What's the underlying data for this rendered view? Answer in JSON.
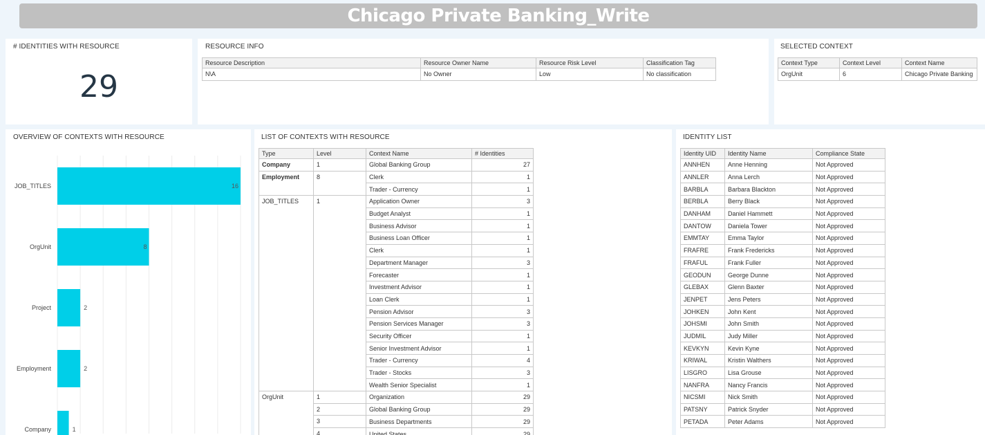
{
  "header": {
    "title": "Chicago Private Banking_Write"
  },
  "identities_panel": {
    "title": "# IDENTITIES WITH RESOURCE",
    "value": "29"
  },
  "resource_info": {
    "title": "RESOURCE INFO",
    "columns": [
      "Resource Description",
      "Resource Owner Name",
      "Resource Risk Level",
      "Classification Tag"
    ],
    "row": [
      "N\\A",
      "No Owner",
      "Low",
      "No classification"
    ]
  },
  "selected_context": {
    "title": "SELECTED CONTEXT",
    "columns": [
      "Context Type",
      "Context Level",
      "Context Name"
    ],
    "row": [
      "OrgUnit",
      "6",
      "Chicago Private Banking"
    ]
  },
  "overview": {
    "title": "OVERVIEW OF CONTEXTS WITH RESOURCE",
    "accent": "#00cfe8"
  },
  "chart_data": {
    "type": "bar",
    "orientation": "horizontal",
    "categories": [
      "JOB_TITLES",
      "OrgUnit",
      "Project",
      "Employment",
      "Company"
    ],
    "values": [
      16,
      8,
      2,
      2,
      1
    ],
    "xlim": [
      0,
      16
    ],
    "grid": true,
    "title": "",
    "xlabel": "",
    "ylabel": ""
  },
  "context_list": {
    "title": "LIST OF CONTEXTS WITH RESOURCE",
    "columns": [
      "Type",
      "Level",
      "Context Name",
      "# Identities"
    ],
    "groups": [
      {
        "type": "Company",
        "bold": true,
        "levels": [
          {
            "level": "1",
            "rows": [
              [
                "Global Banking Group",
                "27"
              ]
            ]
          }
        ]
      },
      {
        "type": "Employment",
        "bold": true,
        "levels": [
          {
            "level": "8",
            "rows": [
              [
                "Clerk",
                "1"
              ],
              [
                "Trader - Currency",
                "1"
              ]
            ]
          }
        ]
      },
      {
        "type": "JOB_TITLES",
        "bold": false,
        "levels": [
          {
            "level": "1",
            "rows": [
              [
                "Application Owner",
                "3"
              ],
              [
                "Budget Analyst",
                "1"
              ],
              [
                "Business Advisor",
                "1"
              ],
              [
                "Business Loan Officer",
                "1"
              ],
              [
                "Clerk",
                "1"
              ],
              [
                "Department Manager",
                "3"
              ],
              [
                "Forecaster",
                "1"
              ],
              [
                "Investment Advisor",
                "1"
              ],
              [
                "Loan Clerk",
                "1"
              ],
              [
                "Pension Advisor",
                "3"
              ],
              [
                "Pension Services Manager",
                "3"
              ],
              [
                "Security Officer",
                "1"
              ],
              [
                "Senior Investment Advisor",
                "1"
              ],
              [
                "Trader - Currency",
                "4"
              ],
              [
                "Trader - Stocks",
                "3"
              ],
              [
                "Wealth Senior Specialist",
                "1"
              ]
            ]
          }
        ]
      },
      {
        "type": "OrgUnit",
        "bold": false,
        "levels": [
          {
            "level": "1",
            "rows": [
              [
                "Organization",
                "29"
              ]
            ]
          },
          {
            "level": "2",
            "rows": [
              [
                "Global Banking Group",
                "29"
              ]
            ]
          },
          {
            "level": "3",
            "rows": [
              [
                "Business Departments",
                "29"
              ]
            ]
          },
          {
            "level": "4",
            "rows": [
              [
                "United States",
                "29"
              ]
            ]
          }
        ]
      }
    ]
  },
  "identity_list": {
    "title": "IDENTITY LIST",
    "columns": [
      "Identity UID",
      "Identity Name",
      "Compliance State"
    ],
    "rows": [
      [
        "ANNHEN",
        "Anne Henning",
        "Not Approved"
      ],
      [
        "ANNLER",
        "Anna Lerch",
        "Not Approved"
      ],
      [
        "BARBLA",
        "Barbara Blackton",
        "Not Approved"
      ],
      [
        "BERBLA",
        "Berry Black",
        "Not Approved"
      ],
      [
        "DANHAM",
        "Daniel Hammett",
        "Not Approved"
      ],
      [
        "DANTOW",
        "Daniela Tower",
        "Not Approved"
      ],
      [
        "EMMTAY",
        "Emma Taylor",
        "Not Approved"
      ],
      [
        "FRAFRE",
        "Frank Fredericks",
        "Not Approved"
      ],
      [
        "FRAFUL",
        "Frank Fuller",
        "Not Approved"
      ],
      [
        "GEODUN",
        "George Dunne",
        "Not Approved"
      ],
      [
        "GLEBAX",
        "Glenn Baxter",
        "Not Approved"
      ],
      [
        "JENPET",
        "Jens Peters",
        "Not Approved"
      ],
      [
        "JOHKEN",
        "John Kent",
        "Not Approved"
      ],
      [
        "JOHSMI",
        "John Smith",
        "Not Approved"
      ],
      [
        "JUDMIL",
        "Judy Miller",
        "Not Approved"
      ],
      [
        "KEVKYN",
        "Kevin Kyne",
        "Not Approved"
      ],
      [
        "KRIWAL",
        "Kristin Walthers",
        "Not Approved"
      ],
      [
        "LISGRO",
        "Lisa Grouse",
        "Not Approved"
      ],
      [
        "NANFRA",
        "Nancy Francis",
        "Not Approved"
      ],
      [
        "NICSMI",
        "Nick Smith",
        "Not Approved"
      ],
      [
        "PATSNY",
        "Patrick Snyder",
        "Not Approved"
      ],
      [
        "PETADA",
        "Peter Adams",
        "Not Approved"
      ]
    ]
  }
}
